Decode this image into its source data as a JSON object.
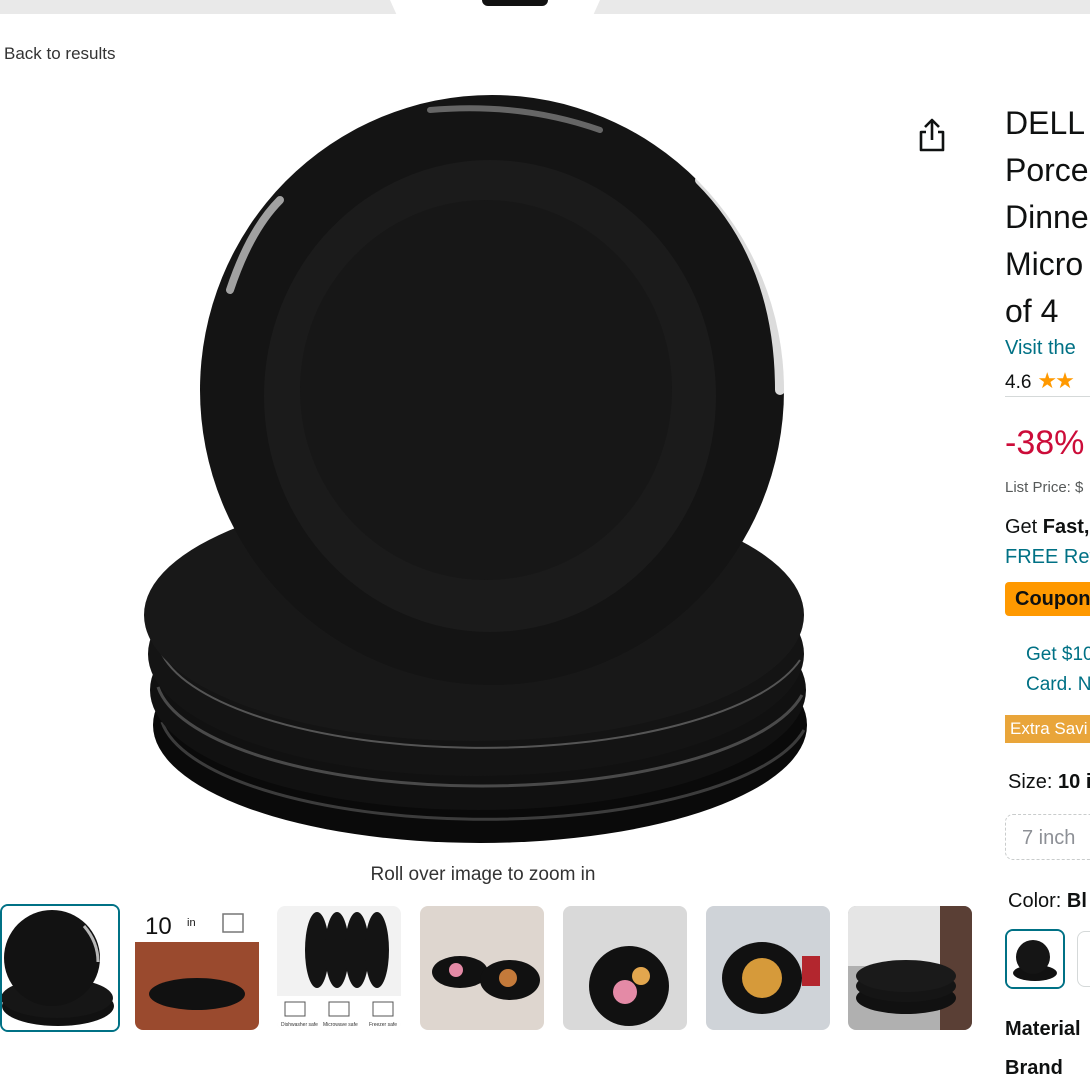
{
  "nav": {
    "back_label": "Back to results"
  },
  "gallery": {
    "zoom_hint": "Roll over image to zoom in",
    "thumb_2_text": "10",
    "thumb_2_unit": "in",
    "thumb_3_captions": [
      "Dishwasher safe",
      "Microwave safe",
      "Freezer safe"
    ]
  },
  "product": {
    "title_lines": [
      "DELL",
      "Porce",
      "Dinne",
      "Micro",
      "of 4"
    ],
    "store_link": "Visit the",
    "rating": "4.6",
    "stars_icon": "star-icon",
    "discount": "-38%",
    "list_price": "List Price: $",
    "get_prefix": "Get ",
    "get_bold": "Fast,",
    "free_returns": "FREE Ret",
    "coupon": "Coupon",
    "promo_line1": "Get $10",
    "promo_line2": "Card. N",
    "extra_savings": "Extra Savi",
    "size_label": "Size: ",
    "size_selected": "10 i",
    "size_option": "7 inch",
    "color_label": "Color: ",
    "color_selected": "Bl",
    "attr_material": "Material",
    "attr_brand": "Brand"
  },
  "colors": {
    "accent": "#007185",
    "deal": "#cc0c39",
    "coupon": "#ff9900",
    "extra": "#e9a53a"
  }
}
